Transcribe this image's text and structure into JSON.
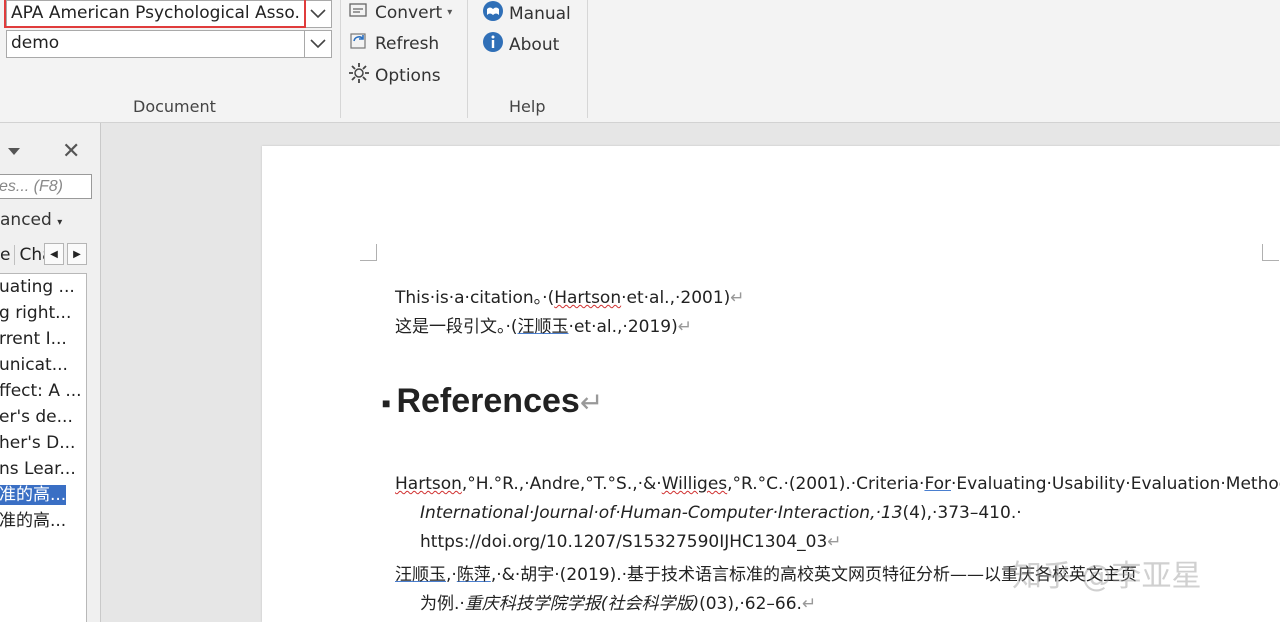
{
  "ribbon": {
    "citation_style_value": "APA American Psychological Asso...",
    "library_value": "demo",
    "document_group": {
      "label": "Document",
      "convert_label": "Convert",
      "refresh_label": "Refresh",
      "options_label": "Options"
    },
    "help_group": {
      "label": "Help",
      "manual_label": "Manual",
      "about_label": "About"
    }
  },
  "panel": {
    "search_placeholder": "es... (F8)",
    "advanced_label": "anced",
    "tabs": [
      "e",
      "Cha"
    ],
    "references": [
      "uating ...",
      "g right...",
      "rrent I...",
      "unicat...",
      "ffect: A ...",
      "er's de...",
      "her's D...",
      "ns Lear...",
      "准的高...",
      "准的高..."
    ],
    "selected_index": 8
  },
  "document": {
    "line1": {
      "a": "This·is·a·citation。·",
      "b": "(",
      "c": "Hartson",
      "d": "·et·al.,·2001)"
    },
    "line2": {
      "a": "这是一段引文。·(",
      "b": "汪顺玉",
      "c": "·et·al.,·2019)"
    },
    "heading": "References",
    "ref1_line1": {
      "a": "Hartson",
      "b": ",°H.°R.,·Andre,°T.°S.,·&·",
      "c": "Williges",
      "d": ",°R.°C.·(2001).·Criteria·",
      "e": "For",
      "f": "·Evaluating·Usability·Evaluation·Methods.·"
    },
    "ref1_line2": {
      "italic": "International·Journal·of·Human-Computer·Interaction,·13",
      "rest": "(4),·373–410.·"
    },
    "ref1_line3": "https://doi.org/10.1207/S15327590IJHC1304_03",
    "ref2_line1": {
      "a": "汪顺玉",
      "b": ",·",
      "c": "陈萍",
      "d": ",·&·胡宇·(2019).·基于技术语言标准的高校英文网页特征分析——以重庆各校英文主页"
    },
    "ref2_line2": {
      "a": "为例.·",
      "italic": "重庆科技学院学报(社会科学版)",
      "rest": "(03),·62–66."
    },
    "para_mark": "↵"
  },
  "watermark": "知乎 @李亚星",
  "colors": {
    "highlight_border": "#e03c3c",
    "selection": "#3a6fc4"
  }
}
